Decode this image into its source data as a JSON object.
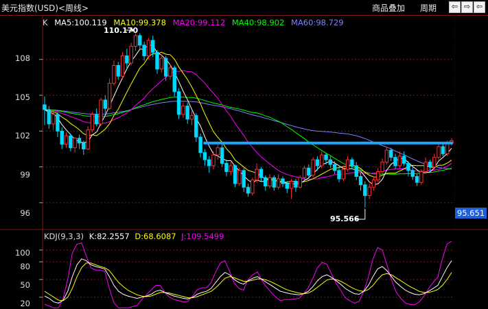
{
  "header": {
    "title": "美元指数(USD)<周线>",
    "overlay_label": "商品叠加",
    "period_label": "周期",
    "nav_prev": "⇦",
    "nav_next": "⇨"
  },
  "main_chart": {
    "indicator_prefix": "K",
    "ma5": "MA5:100.119",
    "ma10": "MA10:99.378",
    "ma20": "MA20:99.112",
    "ma40": "MA40:98.902",
    "ma60": "MA60:98.729",
    "y_ticks": [
      "108",
      "105",
      "102",
      "99",
      "96"
    ],
    "high_annotation": "110.170",
    "low_annotation": "95.566",
    "last_price": "95.651"
  },
  "kdj_chart": {
    "name": "KDJ(9,3,3)",
    "k": "K:82.2557",
    "d": "D:68.6087",
    "j": "J:109.5499",
    "y_ticks": [
      "100",
      "80",
      "50",
      "20"
    ]
  },
  "colors": {
    "ma5": "#ffffff",
    "ma10": "#ffff00",
    "ma20": "#ff00ff",
    "ma40": "#00ff00",
    "ma60": "#8080ff",
    "up": "#ff3030",
    "down": "#00d8ff",
    "border": "#7a1a1a",
    "resistance": "#1aa8ff"
  },
  "chart_data": {
    "type": "candlestick",
    "y_range": [
      94.5,
      110.8
    ],
    "kdj_range": [
      0,
      115
    ],
    "candles": [
      [
        104.2,
        103.8,
        104.9,
        102.5
      ],
      [
        103.8,
        102.6,
        104.1,
        102.2
      ],
      [
        102.6,
        103.4,
        103.7,
        102.1
      ],
      [
        103.4,
        102.0,
        103.6,
        101.5
      ],
      [
        102.0,
        100.9,
        102.3,
        100.5
      ],
      [
        100.9,
        101.6,
        101.9,
        100.6
      ],
      [
        101.6,
        100.6,
        101.8,
        100.3
      ],
      [
        100.6,
        101.4,
        101.5,
        100.2
      ],
      [
        101.4,
        101.0,
        101.7,
        100.5
      ],
      [
        101.0,
        100.5,
        101.2,
        100.0
      ],
      [
        100.5,
        102.1,
        102.4,
        100.4
      ],
      [
        102.1,
        103.4,
        103.6,
        101.9
      ],
      [
        103.4,
        102.6,
        103.9,
        102.4
      ],
      [
        102.6,
        104.6,
        104.8,
        102.4
      ],
      [
        104.6,
        103.9,
        105.0,
        103.5
      ],
      [
        103.9,
        106.0,
        106.4,
        103.8
      ],
      [
        106.0,
        107.5,
        107.9,
        105.8
      ],
      [
        107.5,
        106.6,
        107.8,
        106.3
      ],
      [
        106.6,
        108.3,
        108.6,
        106.4
      ],
      [
        108.3,
        107.7,
        108.9,
        107.3
      ],
      [
        107.7,
        109.1,
        109.4,
        107.5
      ],
      [
        109.1,
        110.0,
        110.2,
        108.7
      ],
      [
        110.0,
        109.2,
        110.2,
        108.9
      ],
      [
        109.2,
        108.3,
        109.5,
        107.9
      ],
      [
        108.3,
        109.6,
        109.8,
        108.0
      ],
      [
        109.6,
        108.6,
        110.0,
        108.2
      ],
      [
        108.6,
        107.2,
        108.8,
        106.8
      ],
      [
        107.2,
        108.1,
        108.4,
        106.9
      ],
      [
        108.1,
        106.6,
        108.3,
        106.2
      ],
      [
        106.6,
        107.3,
        107.6,
        106.3
      ],
      [
        107.3,
        105.3,
        107.5,
        104.9
      ],
      [
        105.3,
        103.4,
        105.6,
        103.0
      ],
      [
        103.4,
        104.1,
        104.4,
        103.1
      ],
      [
        104.1,
        103.0,
        104.4,
        102.6
      ],
      [
        103.0,
        103.3,
        103.7,
        102.5
      ],
      [
        103.3,
        101.5,
        103.5,
        101.1
      ],
      [
        101.5,
        100.2,
        101.8,
        99.8
      ],
      [
        100.2,
        99.6,
        100.5,
        99.1
      ],
      [
        99.6,
        99.1,
        99.9,
        98.5
      ],
      [
        99.1,
        100.0,
        100.3,
        98.8
      ],
      [
        100.0,
        100.6,
        100.9,
        99.6
      ],
      [
        100.6,
        99.3,
        101.0,
        99.0
      ],
      [
        99.3,
        98.6,
        99.6,
        98.2
      ],
      [
        98.6,
        99.1,
        99.4,
        98.3
      ],
      [
        99.1,
        97.6,
        99.2,
        97.3
      ],
      [
        97.6,
        98.7,
        98.9,
        97.4
      ],
      [
        98.7,
        97.3,
        98.9,
        96.9
      ],
      [
        97.3,
        96.8,
        97.6,
        96.5
      ],
      [
        96.8,
        97.9,
        98.1,
        96.6
      ],
      [
        97.9,
        98.8,
        99.3,
        97.7
      ],
      [
        98.8,
        98.1,
        99.0,
        97.8
      ],
      [
        98.1,
        97.4,
        98.3,
        97.0
      ],
      [
        97.4,
        98.1,
        98.4,
        97.2
      ],
      [
        98.1,
        97.3,
        98.3,
        97.0
      ],
      [
        97.3,
        98.0,
        98.4,
        97.1
      ],
      [
        98.0,
        97.6,
        98.2,
        97.3
      ],
      [
        97.6,
        97.2,
        97.8,
        96.8
      ],
      [
        97.2,
        97.8,
        98.0,
        96.3
      ],
      [
        97.8,
        97.3,
        98.0,
        96.9
      ],
      [
        97.3,
        98.1,
        98.3,
        97.2
      ],
      [
        98.1,
        98.9,
        99.1,
        97.9
      ],
      [
        98.9,
        98.3,
        99.2,
        98.0
      ],
      [
        98.3,
        99.6,
        99.8,
        98.1
      ],
      [
        99.6,
        99.1,
        99.9,
        98.7
      ],
      [
        99.1,
        100.0,
        100.3,
        98.9
      ],
      [
        100.0,
        99.6,
        100.2,
        99.2
      ],
      [
        99.6,
        99.2,
        99.9,
        98.9
      ],
      [
        99.2,
        98.7,
        99.5,
        98.4
      ],
      [
        98.7,
        98.0,
        99.0,
        97.7
      ],
      [
        98.0,
        98.8,
        99.1,
        97.8
      ],
      [
        98.8,
        99.6,
        99.9,
        98.6
      ],
      [
        99.6,
        99.1,
        99.8,
        98.8
      ],
      [
        99.1,
        98.2,
        99.4,
        97.9
      ],
      [
        98.2,
        97.5,
        98.5,
        97.0
      ],
      [
        97.5,
        96.6,
        97.8,
        95.6
      ],
      [
        96.6,
        97.3,
        97.6,
        96.3
      ],
      [
        97.3,
        97.9,
        98.2,
        97.0
      ],
      [
        97.9,
        98.6,
        98.9,
        97.7
      ],
      [
        98.6,
        99.4,
        99.7,
        98.4
      ],
      [
        99.4,
        100.4,
        100.7,
        99.2
      ],
      [
        100.4,
        99.8,
        100.6,
        99.5
      ],
      [
        99.8,
        99.1,
        100.1,
        98.8
      ],
      [
        99.1,
        99.9,
        100.3,
        98.9
      ],
      [
        99.9,
        99.3,
        100.3,
        99.1
      ],
      [
        99.3,
        98.7,
        99.5,
        98.2
      ],
      [
        98.7,
        98.2,
        99.0,
        97.9
      ],
      [
        98.2,
        97.7,
        98.4,
        97.4
      ],
      [
        97.7,
        98.6,
        98.8,
        97.5
      ],
      [
        98.6,
        99.4,
        99.8,
        98.4
      ],
      [
        99.4,
        99.0,
        99.6,
        98.7
      ],
      [
        99.0,
        99.8,
        100.1,
        98.8
      ],
      [
        99.8,
        100.7,
        100.9,
        99.6
      ],
      [
        100.7,
        100.1,
        101.0,
        99.9
      ],
      [
        100.1,
        101.0,
        101.2,
        99.9
      ],
      [
        101.0,
        101.2,
        101.4,
        100.8
      ]
    ],
    "kdj": {
      "k": [
        22,
        18,
        12,
        10,
        15,
        30,
        55,
        75,
        85,
        82,
        75,
        72,
        70,
        68,
        55,
        40,
        30,
        25,
        22,
        20,
        18,
        20,
        22,
        25,
        30,
        32,
        28,
        25,
        22,
        20,
        18,
        17,
        20,
        25,
        28,
        30,
        35,
        45,
        55,
        62,
        58,
        50,
        45,
        42,
        48,
        52,
        55,
        50,
        45,
        40,
        35,
        30,
        28,
        26,
        25,
        24,
        26,
        30,
        38,
        48,
        55,
        58,
        54,
        48,
        42,
        35,
        30,
        26,
        25,
        30,
        40,
        55,
        68,
        72,
        65,
        55,
        45,
        38,
        32,
        28,
        25,
        24,
        26,
        30,
        35,
        40,
        55,
        70,
        82
      ],
      "d": [
        30,
        25,
        20,
        15,
        14,
        20,
        35,
        55,
        70,
        78,
        78,
        75,
        72,
        70,
        65,
        55,
        45,
        38,
        32,
        28,
        24,
        22,
        21,
        22,
        25,
        28,
        28,
        27,
        25,
        23,
        21,
        19,
        19,
        21,
        24,
        27,
        30,
        36,
        44,
        52,
        55,
        53,
        50,
        47,
        47,
        49,
        51,
        51,
        49,
        46,
        42,
        38,
        34,
        31,
        29,
        27,
        26,
        27,
        31,
        37,
        43,
        49,
        51,
        50,
        47,
        43,
        38,
        34,
        31,
        30,
        33,
        40,
        50,
        58,
        60,
        58,
        53,
        48,
        43,
        38,
        34,
        30,
        28,
        28,
        30,
        33,
        40,
        50,
        62
      ],
      "j": [
        8,
        5,
        2,
        2,
        18,
        50,
        95,
        110,
        112,
        90,
        70,
        66,
        66,
        64,
        35,
        10,
        2,
        2,
        2,
        4,
        6,
        16,
        24,
        32,
        40,
        40,
        28,
        20,
        16,
        14,
        12,
        13,
        22,
        33,
        36,
        36,
        45,
        63,
        78,
        82,
        64,
        44,
        35,
        32,
        50,
        58,
        63,
        48,
        37,
        28,
        20,
        14,
        16,
        16,
        17,
        18,
        26,
        36,
        52,
        70,
        79,
        76,
        60,
        44,
        32,
        19,
        14,
        10,
        13,
        30,
        54,
        85,
        104,
        100,
        75,
        49,
        29,
        18,
        10,
        8,
        7,
        12,
        22,
        34,
        45,
        54,
        85,
        110,
        115
      ]
    }
  }
}
